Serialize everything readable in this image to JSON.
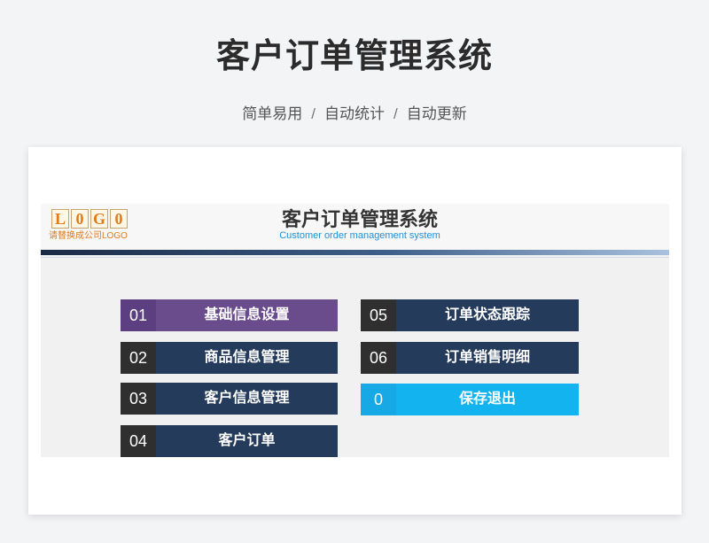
{
  "page": {
    "title": "客户订单管理系统",
    "subtitle_items": [
      "简单易用",
      "自动统计",
      "自动更新"
    ],
    "subtitle_separator": "/"
  },
  "logo": {
    "letters": [
      "L",
      "0",
      "G",
      "0"
    ],
    "caption": "请替换成公司LOGO"
  },
  "system": {
    "title": "客户订单管理系统",
    "subtitle": "Customer order management system"
  },
  "menu": [
    {
      "num": "01",
      "label": "基础信息设置",
      "color": "#6a4b8c"
    },
    {
      "num": "02",
      "label": "商品信息管理",
      "color": "#243b5c"
    },
    {
      "num": "03",
      "label": "客户信息管理",
      "color": "#243b5c"
    },
    {
      "num": "04",
      "label": "客户订单",
      "color": "#243b5c"
    },
    {
      "num": "05",
      "label": "订单状态跟踪",
      "color": "#243b5c"
    },
    {
      "num": "06",
      "label": "订单销售明细",
      "color": "#243b5c"
    },
    {
      "num": "0",
      "label": "保存退出",
      "color": "#12b3ef"
    }
  ]
}
